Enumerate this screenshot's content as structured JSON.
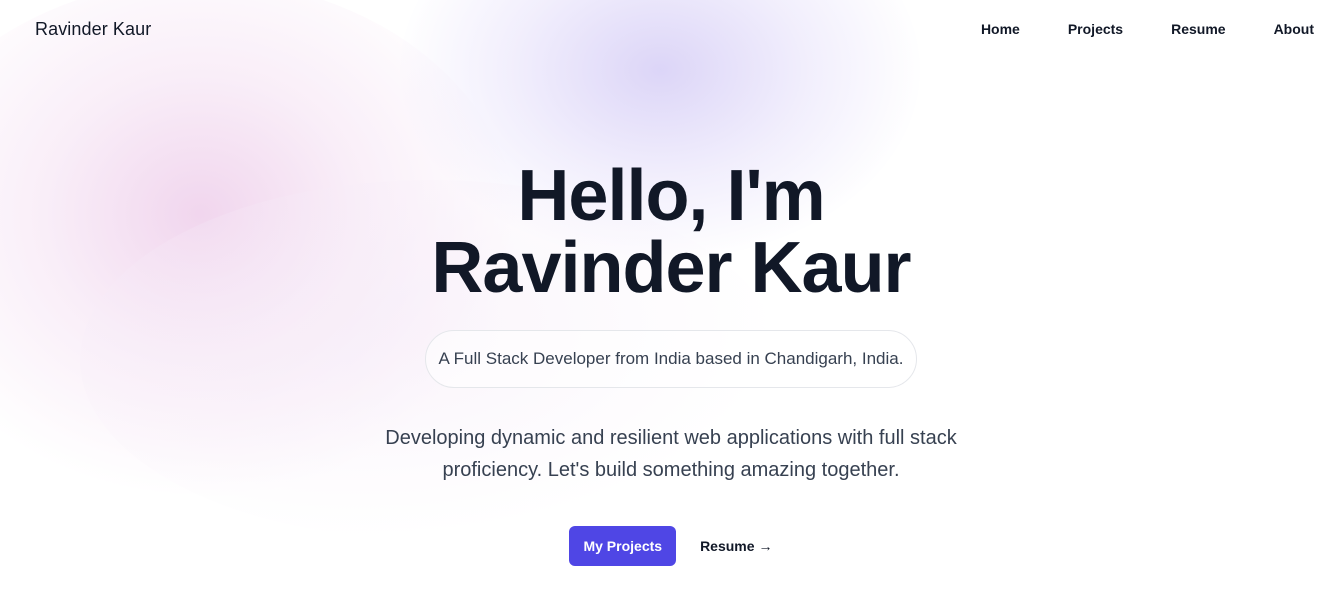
{
  "header": {
    "logo": "Ravinder Kaur",
    "nav": [
      {
        "label": "Home"
      },
      {
        "label": "Projects"
      },
      {
        "label": "Resume"
      },
      {
        "label": "About"
      }
    ]
  },
  "hero": {
    "title_line1": "Hello, I'm",
    "title_line2": "Ravinder Kaur",
    "tagline": "A Full Stack Developer from India based in Chandigarh, India.",
    "description": "Developing dynamic and resilient web applications with full stack proficiency. Let's build something amazing together.",
    "primary_button": "My Projects",
    "secondary_link": "Resume",
    "secondary_icon": "arrow-right-icon"
  },
  "colors": {
    "accent": "#4f46e5",
    "text": "#111827",
    "muted_text": "#374151"
  }
}
